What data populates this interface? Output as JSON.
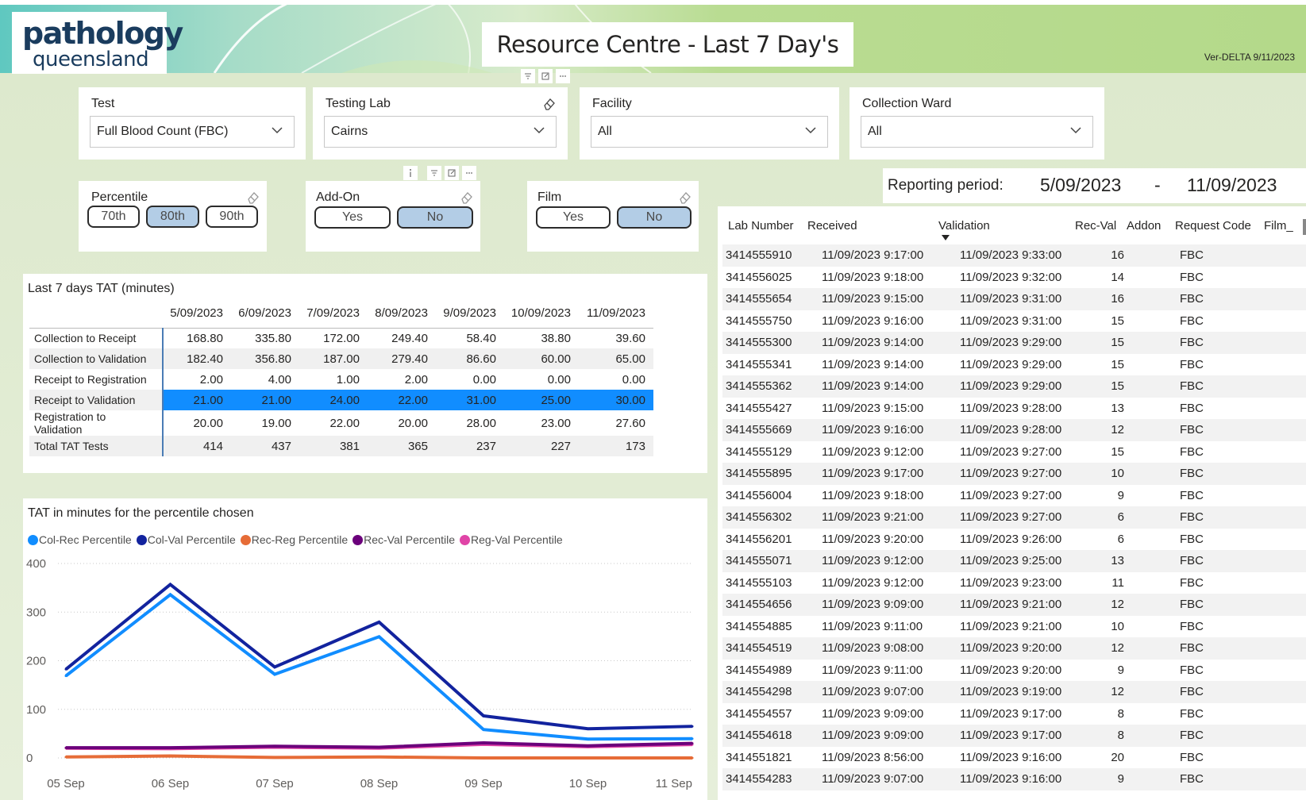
{
  "header": {
    "logo_line1": "pathology",
    "logo_line2": "queensland",
    "title": "Resource Centre - Last 7 Day's",
    "version": "Ver-DELTA 9/11/2023"
  },
  "slicers": {
    "test": {
      "label": "Test",
      "value": "Full Blood Count (FBC)"
    },
    "testing_lab": {
      "label": "Testing Lab",
      "value": "Cairns"
    },
    "facility": {
      "label": "Facility",
      "value": "All"
    },
    "collection_ward": {
      "label": "Collection Ward",
      "value": "All"
    },
    "percentile": {
      "label": "Percentile",
      "options": [
        "70th",
        "80th",
        "90th"
      ],
      "selected": "80th"
    },
    "add_on": {
      "label": "Add-On",
      "options": [
        "Yes",
        "No"
      ],
      "selected": "No"
    },
    "film": {
      "label": "Film",
      "options": [
        "Yes",
        "No"
      ],
      "selected": "No"
    }
  },
  "reporting_period": {
    "label": "Reporting period:",
    "start": "5/09/2023",
    "separator": "-",
    "end": "11/09/2023"
  },
  "tat_table": {
    "title": "Last 7 days TAT (minutes)",
    "columns": [
      "5/09/2023",
      "6/09/2023",
      "7/09/2023",
      "8/09/2023",
      "9/09/2023",
      "10/09/2023",
      "11/09/2023"
    ],
    "rows": [
      {
        "label": "Collection to Receipt",
        "values": [
          "168.80",
          "335.80",
          "172.00",
          "249.40",
          "58.40",
          "38.80",
          "39.60"
        ]
      },
      {
        "label": "Collection to Validation",
        "values": [
          "182.40",
          "356.80",
          "187.00",
          "279.40",
          "86.60",
          "60.00",
          "65.00"
        ]
      },
      {
        "label": "Receipt to Registration",
        "values": [
          "2.00",
          "4.00",
          "1.00",
          "2.00",
          "0.00",
          "0.00",
          "0.00"
        ]
      },
      {
        "label": "Receipt to Validation",
        "values": [
          "21.00",
          "21.00",
          "24.00",
          "22.00",
          "31.00",
          "25.00",
          "30.00"
        ]
      },
      {
        "label": "Registration to Validation",
        "values": [
          "20.00",
          "19.00",
          "22.00",
          "20.00",
          "28.00",
          "23.00",
          "27.60"
        ]
      },
      {
        "label": "Total TAT Tests",
        "values": [
          "414",
          "437",
          "381",
          "365",
          "237",
          "227",
          "173"
        ]
      }
    ]
  },
  "chart_title": "TAT in minutes for the percentile chosen",
  "chart_data": {
    "type": "line",
    "title": "TAT in minutes for the percentile chosen",
    "categories": [
      "05 Sep",
      "06 Sep",
      "07 Sep",
      "08 Sep",
      "09 Sep",
      "10 Sep",
      "11 Sep"
    ],
    "ylim": [
      0,
      400
    ],
    "yticks": [
      0,
      100,
      200,
      300,
      400
    ],
    "legend_position": "top-left",
    "grid": true,
    "series": [
      {
        "name": "Col-Rec Percentile",
        "color": "#118dff",
        "values": [
          168.8,
          335.8,
          172.0,
          249.4,
          58.4,
          38.8,
          39.6
        ]
      },
      {
        "name": "Col-Val Percentile",
        "color": "#12239e",
        "values": [
          182.4,
          356.8,
          187.0,
          279.4,
          86.6,
          60.0,
          65.0
        ]
      },
      {
        "name": "Rec-Reg Percentile",
        "color": "#e66c37",
        "values": [
          2.0,
          4.0,
          1.0,
          2.0,
          0.0,
          0.0,
          0.0
        ]
      },
      {
        "name": "Rec-Val Percentile",
        "color": "#6b007b",
        "values": [
          21.0,
          21.0,
          24.0,
          22.0,
          31.0,
          25.0,
          30.0
        ]
      },
      {
        "name": "Reg-Val Percentile",
        "color": "#e044a7",
        "values": [
          20.0,
          19.0,
          22.0,
          20.0,
          28.0,
          23.0,
          27.6
        ]
      }
    ]
  },
  "detail_table": {
    "columns": [
      "Lab Number",
      "Received",
      "Validation",
      "Rec-Val",
      "Addon",
      "Request Code",
      "Film_"
    ],
    "rows": [
      [
        "3414555910",
        "11/09/2023 9:17:00",
        "11/09/2023 9:33:00",
        "16",
        "FBC"
      ],
      [
        "3414556025",
        "11/09/2023 9:18:00",
        "11/09/2023 9:32:00",
        "14",
        "FBC"
      ],
      [
        "3414555654",
        "11/09/2023 9:15:00",
        "11/09/2023 9:31:00",
        "16",
        "FBC"
      ],
      [
        "3414555750",
        "11/09/2023 9:16:00",
        "11/09/2023 9:31:00",
        "15",
        "FBC"
      ],
      [
        "3414555300",
        "11/09/2023 9:14:00",
        "11/09/2023 9:29:00",
        "15",
        "FBC"
      ],
      [
        "3414555341",
        "11/09/2023 9:14:00",
        "11/09/2023 9:29:00",
        "15",
        "FBC"
      ],
      [
        "3414555362",
        "11/09/2023 9:14:00",
        "11/09/2023 9:29:00",
        "15",
        "FBC"
      ],
      [
        "3414555427",
        "11/09/2023 9:15:00",
        "11/09/2023 9:28:00",
        "13",
        "FBC"
      ],
      [
        "3414555669",
        "11/09/2023 9:16:00",
        "11/09/2023 9:28:00",
        "12",
        "FBC"
      ],
      [
        "3414555129",
        "11/09/2023 9:12:00",
        "11/09/2023 9:27:00",
        "15",
        "FBC"
      ],
      [
        "3414555895",
        "11/09/2023 9:17:00",
        "11/09/2023 9:27:00",
        "10",
        "FBC"
      ],
      [
        "3414556004",
        "11/09/2023 9:18:00",
        "11/09/2023 9:27:00",
        "9",
        "FBC"
      ],
      [
        "3414556302",
        "11/09/2023 9:21:00",
        "11/09/2023 9:27:00",
        "6",
        "FBC"
      ],
      [
        "3414556201",
        "11/09/2023 9:20:00",
        "11/09/2023 9:26:00",
        "6",
        "FBC"
      ],
      [
        "3414555071",
        "11/09/2023 9:12:00",
        "11/09/2023 9:25:00",
        "13",
        "FBC"
      ],
      [
        "3414555103",
        "11/09/2023 9:12:00",
        "11/09/2023 9:23:00",
        "11",
        "FBC"
      ],
      [
        "3414554656",
        "11/09/2023 9:09:00",
        "11/09/2023 9:21:00",
        "12",
        "FBC"
      ],
      [
        "3414554885",
        "11/09/2023 9:11:00",
        "11/09/2023 9:21:00",
        "10",
        "FBC"
      ],
      [
        "3414554519",
        "11/09/2023 9:08:00",
        "11/09/2023 9:20:00",
        "12",
        "FBC"
      ],
      [
        "3414554989",
        "11/09/2023 9:11:00",
        "11/09/2023 9:20:00",
        "9",
        "FBC"
      ],
      [
        "3414554298",
        "11/09/2023 9:07:00",
        "11/09/2023 9:19:00",
        "12",
        "FBC"
      ],
      [
        "3414554557",
        "11/09/2023 9:09:00",
        "11/09/2023 9:17:00",
        "8",
        "FBC"
      ],
      [
        "3414554618",
        "11/09/2023 9:09:00",
        "11/09/2023 9:17:00",
        "8",
        "FBC"
      ],
      [
        "3414551821",
        "11/09/2023 8:56:00",
        "11/09/2023 9:16:00",
        "20",
        "FBC"
      ],
      [
        "3414554283",
        "11/09/2023 9:07:00",
        "11/09/2023 9:16:00",
        "9",
        "FBC"
      ]
    ]
  },
  "colors": {
    "selected_pill": "#b3cde6",
    "row_highlight": "#118dff",
    "logo_text": "#1a3c5e",
    "page_bg": "#e1edd2"
  },
  "icons": [
    "eraser-icon",
    "chevron-down-icon",
    "filter-icon",
    "focus-icon",
    "more-options-icon",
    "info-icon",
    "sort-desc-icon"
  ]
}
